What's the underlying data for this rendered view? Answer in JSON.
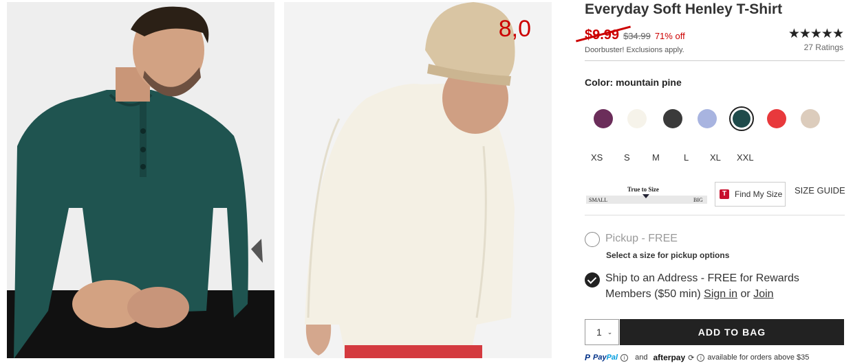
{
  "product": {
    "title": "Everyday Soft Henley T-Shirt",
    "sale_price": "$9.99",
    "original_price": "$34.99",
    "percent_off": "71% off",
    "promo_text": "Doorbuster! Exclusions apply.",
    "stars": "★★★★★",
    "rating": 5,
    "ratings_count": "27 Ratings"
  },
  "gallery": {
    "overlay_number": "8,0"
  },
  "color": {
    "label": "Color: mountain pine",
    "swatches": [
      {
        "name": "purple",
        "hex": "#6b2d5a"
      },
      {
        "name": "cream",
        "hex": "#f6f3ea"
      },
      {
        "name": "charcoal",
        "hex": "#3a3a3a"
      },
      {
        "name": "light blue",
        "hex": "#a8b4e0"
      },
      {
        "name": "mountain pine",
        "hex": "#1f4b4b",
        "selected": true
      },
      {
        "name": "red",
        "hex": "#e8393c"
      },
      {
        "name": "khaki",
        "hex": "#dcccbc"
      }
    ]
  },
  "sizes": [
    "XS",
    "S",
    "M",
    "L",
    "XL",
    "XXL"
  ],
  "fit": {
    "true_to_size_label": "True to Size",
    "small_label": "SMALL",
    "big_label": "BIG",
    "find_my_size_logo": "T",
    "find_my_size_label": "Find My Size",
    "size_guide_label": "SIZE GUIDE"
  },
  "fulfillment": {
    "pickup_label": "Pickup - FREE",
    "pickup_sub": "Select a size for pickup options",
    "ship_line1": "Ship to an Address - FREE for Rewards",
    "ship_line2_prefix": "Members ($50 min) ",
    "sign_in_label": "Sign in",
    "or_label": " or ",
    "join_label": "Join"
  },
  "cart": {
    "quantity": "1",
    "caret": "⌄",
    "add_to_bag_label": "ADD TO BAG"
  },
  "payment": {
    "paypal_logo_p": "P",
    "paypal_logo_pay": "Pay",
    "paypal_logo_pal": "Pal",
    "info_glyph": "i",
    "and_label": "and",
    "afterpay_label": "afterpay",
    "afterpay_glyph": "⟳",
    "available_text": "available for orders above $35"
  }
}
